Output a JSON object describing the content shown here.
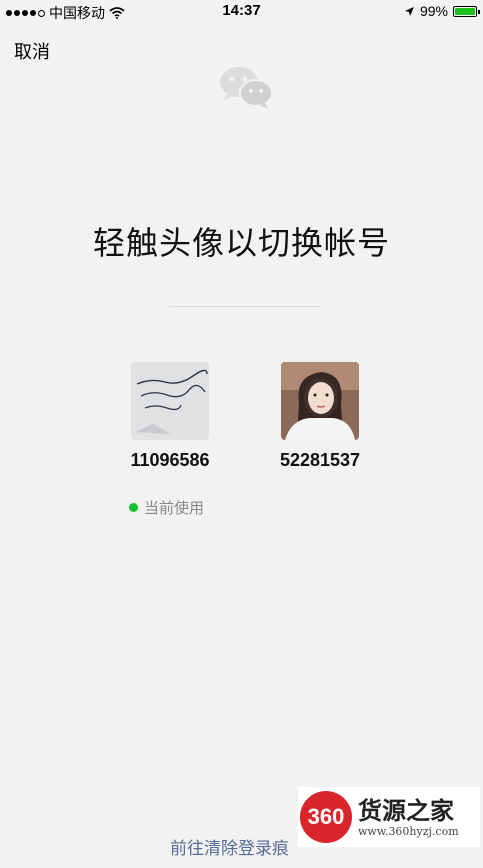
{
  "status_bar": {
    "carrier": "中国移动",
    "time": "14:37",
    "battery_percent": "99%",
    "battery_level": 0.99,
    "signal_bars": 4,
    "signal_total": 5,
    "accent_color": "#1ec01e"
  },
  "nav": {
    "cancel_label": "取消"
  },
  "title": "轻触头像以切换帐号",
  "accounts": [
    {
      "id": "11096586",
      "avatar_icon": "handwriting-avatar"
    },
    {
      "id": "52281537",
      "avatar_icon": "girl-photo-avatar"
    }
  ],
  "current": {
    "label": "当前使用",
    "dot_color": "#19c02a"
  },
  "footer": {
    "clear_link": "前往清除登录痕"
  },
  "watermark": {
    "logo_text": "360",
    "title": "货源之家",
    "url": "www.360hyzj.com"
  }
}
